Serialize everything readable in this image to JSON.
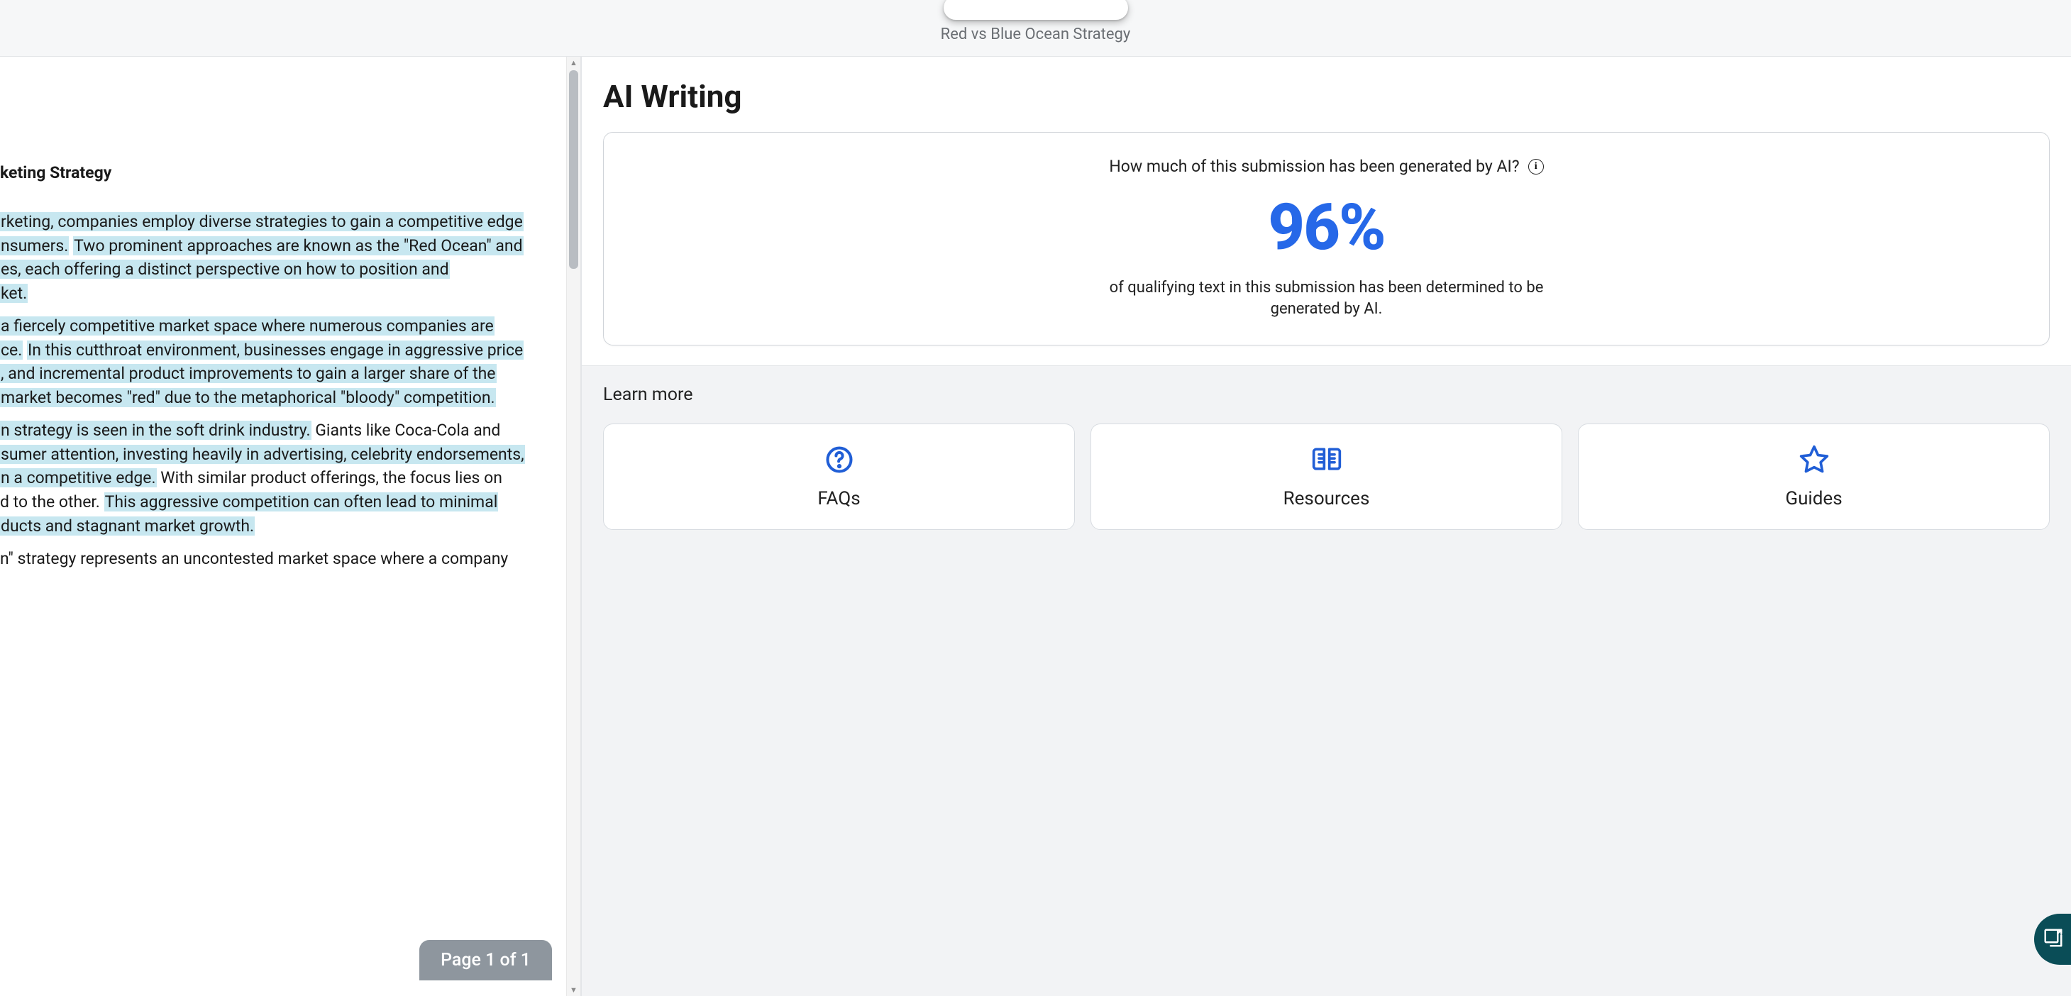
{
  "header": {
    "doc_title": "Red vs Blue Ocean Strategy"
  },
  "document": {
    "heading": "keting Strategy",
    "paragraphs": [
      {
        "segments": [
          {
            "h": true,
            "t": "rketing, companies employ diverse strategies to gain a competitive edge"
          }
        ]
      },
      {
        "segments": [
          {
            "h": true,
            "t": "nsumers."
          },
          {
            "h": false,
            "t": " "
          },
          {
            "h": true,
            "t": "Two prominent approaches are known as the \"Red Ocean\" and"
          }
        ]
      },
      {
        "segments": [
          {
            "h": true,
            "t": "es, each offering a distinct perspective on how to position and"
          }
        ]
      },
      {
        "segments": [
          {
            "h": true,
            "t": "ket."
          }
        ]
      },
      {
        "segments": [
          {
            "h": false,
            "t": ""
          }
        ],
        "spacer": true
      },
      {
        "segments": [
          {
            "h": true,
            "t": "a fiercely competitive market space where numerous companies are"
          }
        ]
      },
      {
        "segments": [
          {
            "h": true,
            "t": "ce."
          },
          {
            "h": false,
            "t": " "
          },
          {
            "h": true,
            "t": "In this cutthroat environment, businesses engage in aggressive price"
          }
        ]
      },
      {
        "segments": [
          {
            "h": true,
            "t": ", and incremental product improvements to gain a larger share of the"
          }
        ]
      },
      {
        "segments": [
          {
            "h": true,
            "t": "market becomes \"red\" due to the metaphorical \"bloody\" competition."
          }
        ]
      },
      {
        "segments": [
          {
            "h": false,
            "t": ""
          }
        ],
        "spacer": true
      },
      {
        "segments": [
          {
            "h": true,
            "t": "n strategy is seen in the soft drink industry."
          },
          {
            "h": false,
            "t": " Giants like Coca-Cola and"
          }
        ]
      },
      {
        "segments": [
          {
            "h": true,
            "t": "sumer attention, investing heavily in advertising, celebrity endorsements,"
          }
        ]
      },
      {
        "segments": [
          {
            "h": true,
            "t": "n a competitive edge."
          },
          {
            "h": false,
            "t": " With similar product offerings, the focus lies on"
          }
        ]
      },
      {
        "segments": [
          {
            "h": false,
            "t": "d to the other. "
          },
          {
            "h": true,
            "t": "This aggressive competition can often lead to minimal"
          }
        ]
      },
      {
        "segments": [
          {
            "h": true,
            "t": "ducts and stagnant market growth."
          }
        ]
      },
      {
        "segments": [
          {
            "h": false,
            "t": ""
          }
        ],
        "spacer": true
      },
      {
        "segments": [
          {
            "h": false,
            "t": "n\" strategy represents an uncontested market space where a company"
          }
        ]
      }
    ],
    "page_badge": "Page 1 of 1"
  },
  "ai_panel": {
    "title": "AI Writing",
    "question": "How much of this submission has been generated by AI?",
    "percent": "96%",
    "description": "of qualifying text in this submission has been determined to be generated by AI.",
    "learn_more_label": "Learn more",
    "cards": [
      {
        "id": "faqs",
        "label": "FAQs",
        "icon": "help-circle-icon"
      },
      {
        "id": "resources",
        "label": "Resources",
        "icon": "book-open-icon"
      },
      {
        "id": "guides",
        "label": "Guides",
        "icon": "star-icon"
      }
    ]
  },
  "colors": {
    "accent_blue": "#2668e8",
    "highlight": "#c7e7f0",
    "teal": "#0a4d57"
  }
}
